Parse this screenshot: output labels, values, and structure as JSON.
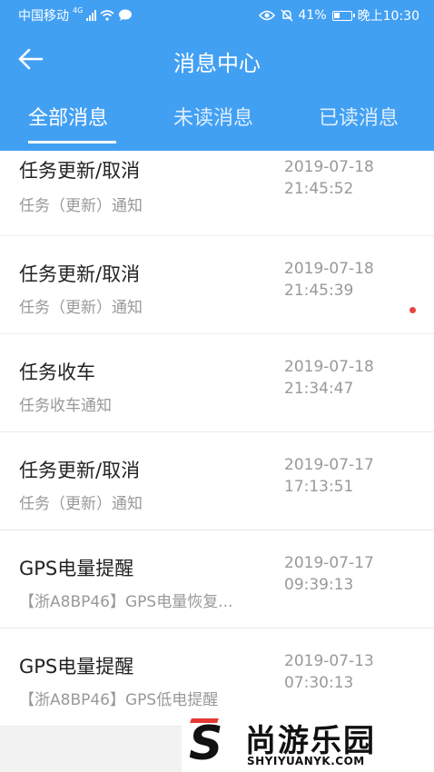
{
  "status_bar": {
    "carrier": "中国移动",
    "network": "4G",
    "battery": "41%",
    "time": "晚上10:30"
  },
  "header": {
    "title": "消息中心"
  },
  "tabs": [
    {
      "label": "全部消息",
      "active": true
    },
    {
      "label": "未读消息",
      "active": false
    },
    {
      "label": "已读消息",
      "active": false
    }
  ],
  "messages": [
    {
      "title": "任务更新/取消",
      "subtitle": "任务（更新）通知",
      "date": "2019-07-18",
      "time": "21:45:52",
      "unread": false
    },
    {
      "title": "任务更新/取消",
      "subtitle": "任务（更新）通知",
      "date": "2019-07-18",
      "time": "21:45:39",
      "unread": true
    },
    {
      "title": "任务收车",
      "subtitle": "任务收车通知",
      "date": "2019-07-18",
      "time": "21:34:47",
      "unread": false
    },
    {
      "title": "任务更新/取消",
      "subtitle": "任务（更新）通知",
      "date": "2019-07-17",
      "time": "17:13:51",
      "unread": false
    },
    {
      "title": "GPS电量提醒",
      "subtitle": "【浙A8BP46】GPS电量恢复...",
      "date": "2019-07-17",
      "time": "09:39:13",
      "unread": false
    },
    {
      "title": "GPS电量提醒",
      "subtitle": "【浙A8BP46】GPS低电提醒",
      "date": "2019-07-13",
      "time": "07:30:13",
      "unread": false
    }
  ],
  "watermark": {
    "logo_letter": "S",
    "brand_cn": "尚游乐园",
    "brand_en": "SHYIYUANYK.COM"
  },
  "colors": {
    "header_bg": "#42a0f3",
    "unread_dot": "#e84343"
  },
  "icons": [
    "back-arrow-icon",
    "signal-icon",
    "wifi-icon",
    "message-bubble-icon",
    "eye-icon",
    "mute-bell-icon",
    "battery-icon"
  ]
}
